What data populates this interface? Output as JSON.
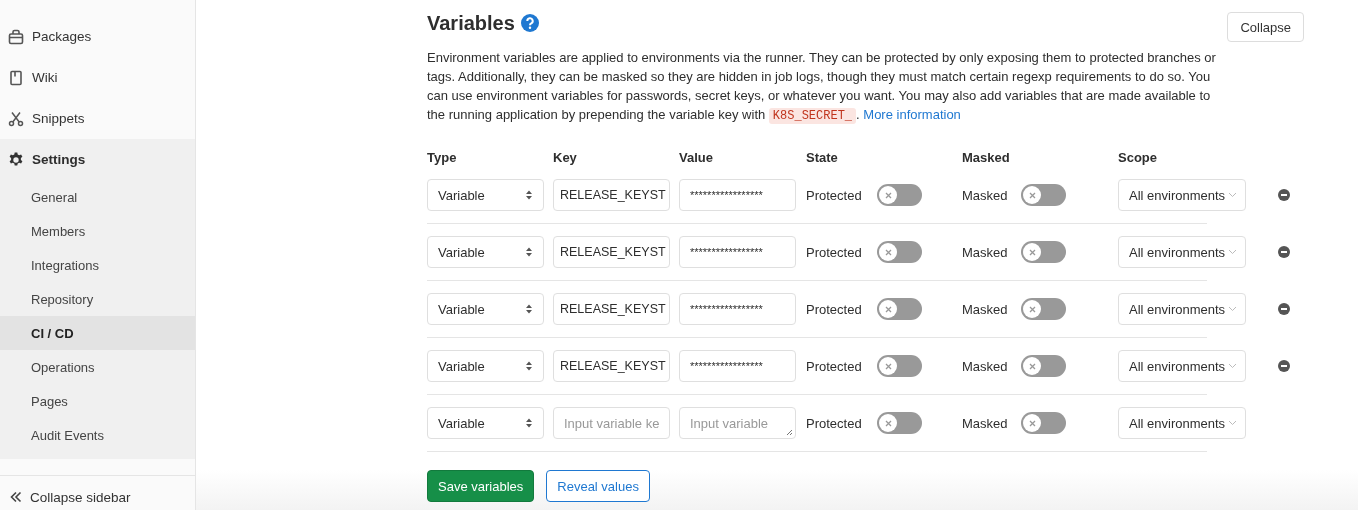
{
  "sidebar": {
    "items": [
      {
        "label": "Packages"
      },
      {
        "label": "Wiki"
      },
      {
        "label": "Snippets"
      }
    ],
    "settings": {
      "label": "Settings",
      "expanded": true,
      "children": [
        {
          "label": "General",
          "selected": false
        },
        {
          "label": "Members",
          "selected": false
        },
        {
          "label": "Integrations",
          "selected": false
        },
        {
          "label": "Repository",
          "selected": false
        },
        {
          "label": "CI / CD",
          "selected": true
        },
        {
          "label": "Operations",
          "selected": false
        },
        {
          "label": "Pages",
          "selected": false
        },
        {
          "label": "Audit Events",
          "selected": false
        }
      ]
    },
    "collapse": "Collapse sidebar"
  },
  "section": {
    "title": "Variables",
    "collapse_button": "Collapse",
    "description": [
      "Environment variables are applied to environments via the runner. They can be protected by only exposing them to protected branches or tags. Additionally, they can be masked so they are hidden in job logs, though they must match certain regexp requirements to do so. You can use environment variables for passwords, secret keys, or whatever you want. You may also add variables that are made available to the running application by prepending the variable key with ",
      "K8S_SECRET_",
      ". ",
      "More information"
    ],
    "columns": [
      "Type",
      "Key",
      "Value",
      "State",
      "Masked",
      "Scope"
    ],
    "rows": [
      {
        "type": "Variable",
        "key": "RELEASE_KEYST",
        "value": "*****************",
        "state_label": "Protected",
        "protected": false,
        "masked_label": "Masked",
        "masked": false,
        "scope": "All environments",
        "removable": true
      },
      {
        "type": "Variable",
        "key": "RELEASE_KEYST",
        "value": "*****************",
        "state_label": "Protected",
        "protected": false,
        "masked_label": "Masked",
        "masked": false,
        "scope": "All environments",
        "removable": true
      },
      {
        "type": "Variable",
        "key": "RELEASE_KEYST",
        "value": "*****************",
        "state_label": "Protected",
        "protected": false,
        "masked_label": "Masked",
        "masked": false,
        "scope": "All environments",
        "removable": true
      },
      {
        "type": "Variable",
        "key": "RELEASE_KEYST",
        "value": "*****************",
        "state_label": "Protected",
        "protected": false,
        "masked_label": "Masked",
        "masked": false,
        "scope": "All environments",
        "removable": true
      },
      {
        "type": "Variable",
        "key_placeholder": "Input variable ke",
        "value_placeholder": "Input variable",
        "state_label": "Protected",
        "protected": false,
        "masked_label": "Masked",
        "masked": false,
        "scope": "All environments",
        "removable": false
      }
    ],
    "buttons": [
      {
        "label": "Save variables",
        "kind": "primary"
      },
      {
        "label": "Reveal values",
        "kind": "secondary"
      }
    ]
  }
}
